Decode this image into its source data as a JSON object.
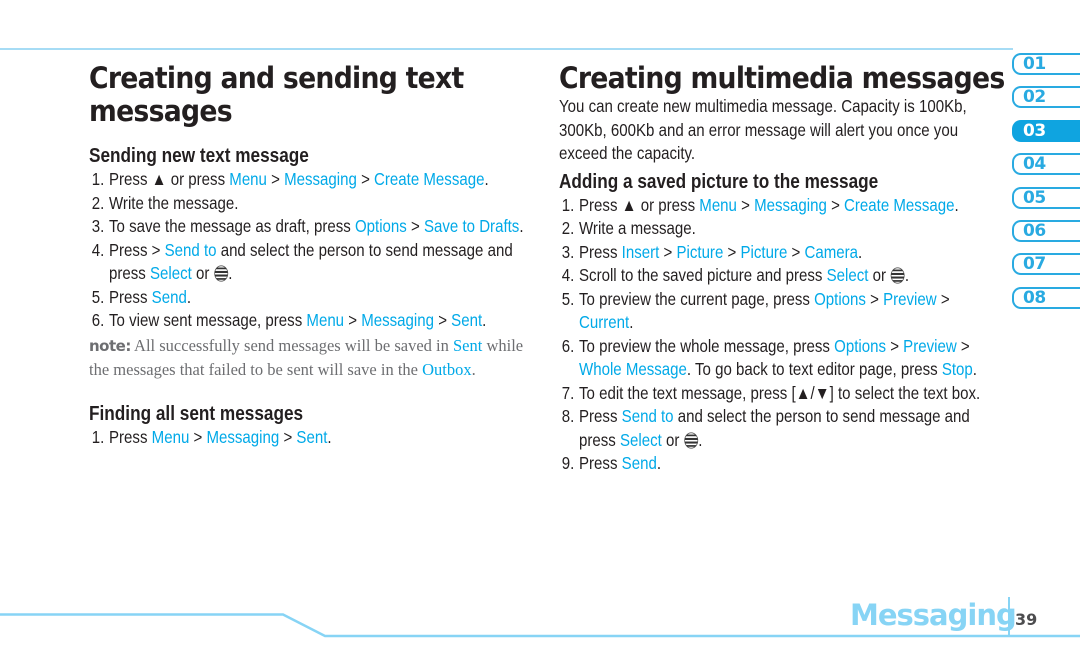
{
  "colors": {
    "accent": "#00a9e8",
    "tab_accent": "#29aae1",
    "rule": "#a6dcf5",
    "footer": "#87d4f5",
    "text": "#231f20",
    "note": "#6d6e71"
  },
  "left": {
    "title_line1": "Creating and sending text",
    "title_line2": "messages",
    "section1": {
      "heading": "Sending new text message",
      "steps": [
        {
          "num": "1.",
          "parts": [
            {
              "t": "Press ▲ or press "
            },
            {
              "t": "Menu",
              "hl": true
            },
            {
              "t": " > "
            },
            {
              "t": "Messaging",
              "hl": true
            },
            {
              "t": " > "
            },
            {
              "t": "Create Message",
              "hl": true
            },
            {
              "t": "."
            }
          ]
        },
        {
          "num": "2.",
          "parts": [
            {
              "t": "Write the message."
            }
          ]
        },
        {
          "num": "3.",
          "parts": [
            {
              "t": "To save the message as draft, press "
            },
            {
              "t": "Options",
              "hl": true
            },
            {
              "t": " > "
            },
            {
              "t": "Save to Drafts",
              "hl": true
            },
            {
              "t": "."
            }
          ]
        },
        {
          "num": "4.",
          "parts": [
            {
              "t": "Press > "
            },
            {
              "t": "Send to",
              "hl": true
            },
            {
              "t": " and select the person to send message and press "
            },
            {
              "t": "Select",
              "hl": true
            },
            {
              "t": " or "
            },
            {
              "icon": "att-globe-icon"
            },
            {
              "t": "."
            }
          ]
        },
        {
          "num": "5.",
          "parts": [
            {
              "t": "Press "
            },
            {
              "t": "Send",
              "hl": true
            },
            {
              "t": "."
            }
          ]
        },
        {
          "num": "6.",
          "parts": [
            {
              "t": "To view sent message, press "
            },
            {
              "t": "Menu",
              "hl": true
            },
            {
              "t": " > "
            },
            {
              "t": "Messaging",
              "hl": true
            },
            {
              "t": " > "
            },
            {
              "t": "Sent",
              "hl": true
            },
            {
              "t": "."
            }
          ]
        }
      ],
      "note_label": "note:",
      "note_parts": [
        {
          "t": " All successfully send messages will be saved in "
        },
        {
          "t": "Sent",
          "hl": true
        },
        {
          "t": " while the messages that failed to be sent will save in the "
        },
        {
          "t": "Outbox",
          "hl": true
        },
        {
          "t": "."
        }
      ]
    },
    "section2": {
      "heading": "Finding all sent messages",
      "steps": [
        {
          "num": "1.",
          "parts": [
            {
              "t": "Press "
            },
            {
              "t": "Menu",
              "hl": true
            },
            {
              "t": " > "
            },
            {
              "t": "Messaging",
              "hl": true
            },
            {
              "t": " > "
            },
            {
              "t": "Sent",
              "hl": true
            },
            {
              "t": "."
            }
          ]
        }
      ]
    }
  },
  "right": {
    "title": "Creating multimedia messages",
    "intro": "You can create new multimedia message. Capacity is 100Kb, 300Kb, 600Kb and an error message will alert you once you exceed the capacity.",
    "section": {
      "heading": "Adding a saved picture to the message",
      "steps": [
        {
          "num": "1.",
          "parts": [
            {
              "t": "Press ▲ or press "
            },
            {
              "t": "Menu",
              "hl": true
            },
            {
              "t": " > "
            },
            {
              "t": "Messaging",
              "hl": true
            },
            {
              "t": " > "
            },
            {
              "t": "Create Message",
              "hl": true
            },
            {
              "t": "."
            }
          ]
        },
        {
          "num": "2.",
          "parts": [
            {
              "t": "Write a message."
            }
          ]
        },
        {
          "num": "3.",
          "parts": [
            {
              "t": "Press "
            },
            {
              "t": "Insert",
              "hl": true
            },
            {
              "t": " > "
            },
            {
              "t": "Picture",
              "hl": true
            },
            {
              "t": " > "
            },
            {
              "t": "Picture",
              "hl": true
            },
            {
              "t": " > "
            },
            {
              "t": "Camera",
              "hl": true
            },
            {
              "t": "."
            }
          ]
        },
        {
          "num": "4.",
          "parts": [
            {
              "t": "Scroll to the saved picture and press "
            },
            {
              "t": "Select",
              "hl": true
            },
            {
              "t": " or "
            },
            {
              "icon": "att-globe-icon"
            },
            {
              "t": "."
            }
          ]
        },
        {
          "num": "5.",
          "parts": [
            {
              "t": "To preview the current page, press "
            },
            {
              "t": "Options",
              "hl": true
            },
            {
              "t": " > "
            },
            {
              "t": "Preview",
              "hl": true
            },
            {
              "t": " > "
            },
            {
              "t": "Current",
              "hl": true
            },
            {
              "t": "."
            }
          ]
        },
        {
          "num": "6.",
          "parts": [
            {
              "t": "To preview the whole message, press "
            },
            {
              "t": "Options",
              "hl": true
            },
            {
              "t": " > "
            },
            {
              "t": "Preview",
              "hl": true
            },
            {
              "t": " > "
            },
            {
              "t": "Whole Message",
              "hl": true
            },
            {
              "t": ". To go back to text editor page, press "
            },
            {
              "t": "Stop",
              "hl": true
            },
            {
              "t": "."
            }
          ]
        },
        {
          "num": "7.",
          "parts": [
            {
              "t": "To edit the text message, press [▲/▼] to select the text box."
            }
          ]
        },
        {
          "num": "8.",
          "parts": [
            {
              "t": "Press "
            },
            {
              "t": "Send to",
              "hl": true
            },
            {
              "t": " and select the person to send message and press "
            },
            {
              "t": "Select",
              "hl": true
            },
            {
              "t": " or "
            },
            {
              "icon": "att-globe-icon"
            },
            {
              "t": "."
            }
          ]
        },
        {
          "num": "9.",
          "parts": [
            {
              "t": "Press "
            },
            {
              "t": "Send",
              "hl": true
            },
            {
              "t": "."
            }
          ]
        }
      ]
    }
  },
  "chapter_tabs": [
    {
      "label": "01",
      "active": false
    },
    {
      "label": "02",
      "active": false
    },
    {
      "label": "03",
      "active": true
    },
    {
      "label": "04",
      "active": false
    },
    {
      "label": "05",
      "active": false
    },
    {
      "label": "06",
      "active": false
    },
    {
      "label": "07",
      "active": false
    },
    {
      "label": "08",
      "active": false
    }
  ],
  "footer": {
    "section": "Messaging",
    "page": "39"
  }
}
